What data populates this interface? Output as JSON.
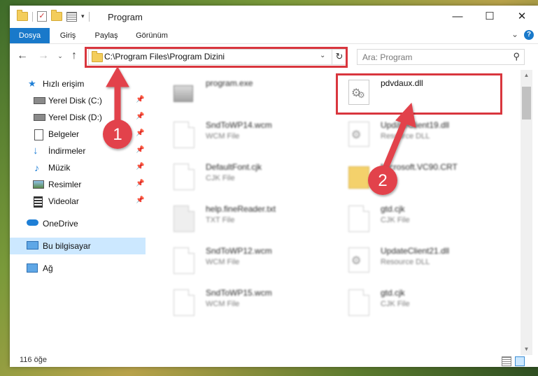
{
  "window": {
    "title": "Program",
    "controls": {
      "minimize": "—",
      "maximize": "☐",
      "close": "✕"
    }
  },
  "ribbon": {
    "tabs": [
      "Dosya",
      "Giriş",
      "Paylaş",
      "Görünüm"
    ]
  },
  "address": {
    "path": "C:\\Program Files\\Program Dizini",
    "search_placeholder": "Ara: Program"
  },
  "sidebar": {
    "items": [
      {
        "label": "Hızlı erişim",
        "icon": "star-icon",
        "pinned": false
      },
      {
        "label": "Yerel Disk (C:)",
        "icon": "drive-icon",
        "pinned": true
      },
      {
        "label": "Yerel Disk (D:)",
        "icon": "drive-icon",
        "pinned": true
      },
      {
        "label": "Belgeler",
        "icon": "documents-icon",
        "pinned": true
      },
      {
        "label": "İndirmeler",
        "icon": "download-icon",
        "pinned": true
      },
      {
        "label": "Müzik",
        "icon": "music-icon",
        "pinned": true
      },
      {
        "label": "Resimler",
        "icon": "pictures-icon",
        "pinned": true
      },
      {
        "label": "Videolar",
        "icon": "videos-icon",
        "pinned": true
      },
      {
        "label": "OneDrive",
        "icon": "cloud-icon",
        "pinned": false
      },
      {
        "label": "Bu bilgisayar",
        "icon": "computer-icon",
        "pinned": false,
        "selected": true
      },
      {
        "label": "Ağ",
        "icon": "network-icon",
        "pinned": false
      }
    ]
  },
  "files": {
    "left": [
      {
        "name": "program.exe",
        "type": ""
      },
      {
        "name": "SndToWP14.wcm",
        "type": "WCM File"
      },
      {
        "name": "DefaultFont.cjk",
        "type": "CJK File"
      },
      {
        "name": "help.fineReader.txt",
        "type": "TXT File"
      },
      {
        "name": "SndToWP12.wcm",
        "type": "WCM File"
      },
      {
        "name": "SndToWP15.wcm",
        "type": "WCM File"
      }
    ],
    "right": [
      {
        "name": "pdvdaux.dll",
        "type": ""
      },
      {
        "name": "UpdateClient19.dll",
        "type": "Resource DLL"
      },
      {
        "name": "Microsoft.VC90.CRT",
        "type": ""
      },
      {
        "name": "gtd.cjk",
        "type": "CJK File"
      },
      {
        "name": "UpdateClient21.dll",
        "type": "Resource DLL"
      },
      {
        "name": "gtd.cjk",
        "type": "CJK File"
      }
    ]
  },
  "status": {
    "item_count": "116 öğe"
  },
  "annotations": {
    "step1": "1",
    "step2": "2",
    "color": "#d9363e"
  }
}
